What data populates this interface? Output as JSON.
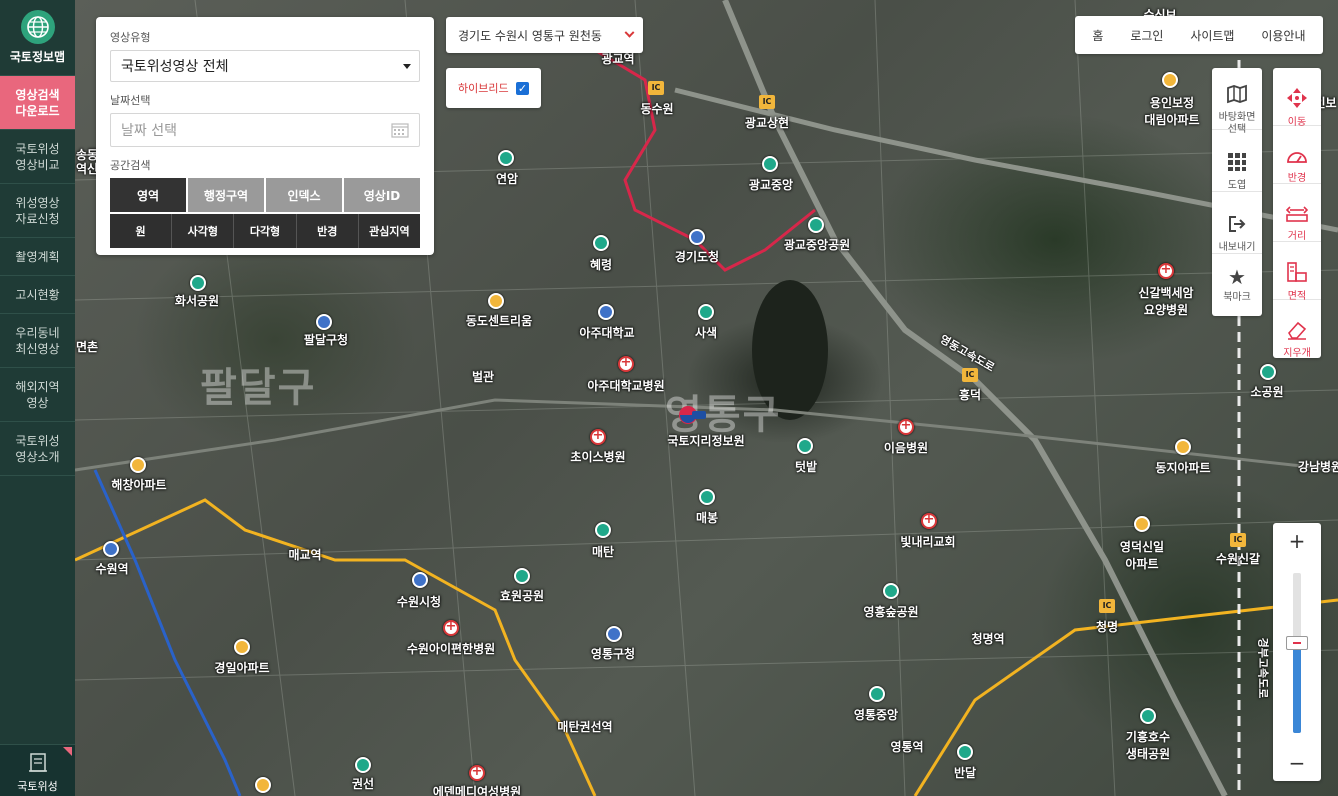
{
  "sidebar": {
    "brand": "국토정보맵",
    "items": [
      {
        "label": "영상검색\n다운로드",
        "active": true
      },
      {
        "label": "국토위성\n영상비교",
        "active": false
      },
      {
        "label": "위성영상\n자료신청",
        "active": false
      },
      {
        "label": "촬영계획",
        "active": false
      },
      {
        "label": "고시현황",
        "active": false
      },
      {
        "label": "우리동네\n최신영상",
        "active": false
      },
      {
        "label": "해외지역\n영상",
        "active": false
      },
      {
        "label": "국토위성\n영상소개",
        "active": false
      }
    ],
    "bottom_label": "국토위성"
  },
  "search_panel": {
    "image_type_label": "영상유형",
    "image_type_value": "국토위성영상 전체",
    "date_label": "날짜선택",
    "date_placeholder": "날짜 선택",
    "spatial_label": "공간검색",
    "tabs": [
      "영역",
      "행정구역",
      "인덱스",
      "영상ID"
    ],
    "active_tab": "영역",
    "shapes": [
      "원",
      "사각형",
      "다각형",
      "반경",
      "관심지역"
    ]
  },
  "location": {
    "value": "경기도 수원시 영통구 원천동"
  },
  "hybrid": {
    "label": "하이브리드",
    "checked": true
  },
  "topnav": [
    "홈",
    "로그인",
    "사이트맵",
    "이용안내"
  ],
  "tools_left": [
    {
      "label": "바탕화면\n선택",
      "icon": "map-icon"
    },
    {
      "label": "도엽",
      "icon": "grid-icon"
    },
    {
      "label": "내보내기",
      "icon": "export-icon"
    },
    {
      "label": "북마크",
      "icon": "star-icon"
    }
  ],
  "tools_right": [
    {
      "label": "이동",
      "icon": "move-icon"
    },
    {
      "label": "반경",
      "icon": "radius-icon"
    },
    {
      "label": "거리",
      "icon": "distance-icon"
    },
    {
      "label": "면적",
      "icon": "area-icon"
    },
    {
      "label": "지우개",
      "icon": "eraser-icon"
    }
  ],
  "zoom": {
    "plus": "+",
    "minus": "−",
    "level_fraction": 0.56
  },
  "map": {
    "districts": [
      "팔달구",
      "영통구"
    ],
    "labels": [
      "용인보정\n대림아파트",
      "광교상현",
      "동수원",
      "연암",
      "광교중앙",
      "광교중앙공원",
      "경기도청",
      "화서공원",
      "혜령",
      "팔달구청",
      "동도센트리움",
      "아주대학교",
      "사색",
      "신갈백세암\n요양병원",
      "흥덕",
      "이음병원",
      "아주대학교병원",
      "벌관",
      "국토지리정보원",
      "초이스병원",
      "텃밭",
      "매봉",
      "매탄",
      "빛내리교회",
      "영덕신일\n아파트",
      "수원신갈",
      "해창아파트",
      "매교역",
      "수원역",
      "수원시청",
      "효원공원",
      "영흥숲공원",
      "청명역",
      "청명",
      "수원아이편한병원",
      "영통구청",
      "경일아파트",
      "매탄권선역",
      "영통중앙",
      "영통역",
      "기흥호수\n생태공원",
      "반달",
      "권선",
      "에덴메디여성병원",
      "소공원",
      "동지아파트",
      "강남병원",
      "면촌",
      "송동",
      "역신",
      "용인보",
      "광교역",
      "수신보"
    ],
    "roads": [
      "영동고속도로",
      "경부고속도로"
    ]
  }
}
